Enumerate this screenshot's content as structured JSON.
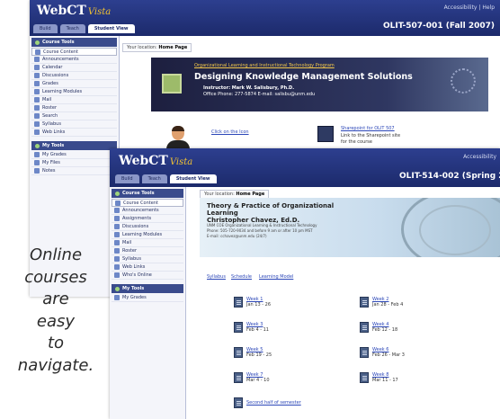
{
  "window_back": {
    "logo": "WebCT",
    "logo_sub": "Vista",
    "utility_links": "Accessibility | Help",
    "course_id": "OLIT-507-001 (Fall 2007)",
    "tabs": [
      "Build",
      "Teach",
      "Student View"
    ],
    "active_tab": "Student View",
    "breadcrumb_label": "Your location:",
    "breadcrumb_page": "Home Page",
    "sidebar": {
      "course_tools_heading": "Course Tools",
      "course_tools": [
        "Course Content",
        "Announcements",
        "Calendar",
        "Discussions",
        "Grades",
        "Learning Modules",
        "Mail",
        "Roster",
        "Search",
        "Syllabus",
        "Web Links"
      ],
      "my_tools_heading": "My Tools",
      "my_tools": [
        "My Grades",
        "My Files",
        "Notes"
      ]
    },
    "banner": {
      "program": "Organizational Learning and Instructional Technology Program",
      "title": "Designing Knowledge Management Solutions",
      "instructor": "Instructor: Mark W. Salisbury, Ph.D.",
      "office": "Office Phone: 277-5874  E-mail: salisbu@unm.edu"
    },
    "click_link": "Click on the Icon",
    "sharepoint_link": "Sharepoint for OLIT 507",
    "sharepoint_desc": "Link to the Sharepoint site for the course"
  },
  "window_front": {
    "logo": "WebCT",
    "logo_sub": "Vista",
    "utility_links": "Accessibility",
    "course_id": "OLIT-514-002 (Spring 2",
    "tabs": [
      "Build",
      "Teach",
      "Student View"
    ],
    "active_tab": "Student View",
    "breadcrumb_label": "Your location:",
    "breadcrumb_page": "Home Page",
    "sidebar": {
      "course_tools_heading": "Course Tools",
      "course_tools": [
        "Course Content",
        "Announcements",
        "Assignments",
        "Discussions",
        "Learning Modules",
        "Mail",
        "Roster",
        "Syllabus",
        "Web Links",
        "Who's Online"
      ],
      "my_tools_heading": "My Tools",
      "my_tools": [
        "My Grades"
      ]
    },
    "banner": {
      "title": "Theory & Practice of Organizational Learning",
      "instructor": "Christopher Chavez, Ed.D.",
      "line1": "UNM COE Organizational Learning & Instructional Technology",
      "line2": "Phone: 505-720-9034 and before 9 am or after 10 pm MST",
      "line3": "E-mail: cchavez@unm.edu (24/7)"
    },
    "nav_links": [
      "Syllabus",
      "Schedule",
      "Learning Model"
    ],
    "weeks": [
      {
        "label": "Week 1",
        "dates": "Jan 13 - 26"
      },
      {
        "label": "Week 2",
        "dates": "Jan 28 - Feb 4"
      },
      {
        "label": "Week 3",
        "dates": "Feb 4 - 11"
      },
      {
        "label": "Week 4",
        "dates": "Feb 12 - 18"
      },
      {
        "label": "Week 5",
        "dates": "Feb 19 - 25"
      },
      {
        "label": "Week 6",
        "dates": "Feb 26 - Mar 3"
      },
      {
        "label": "Week 7",
        "dates": "Mar 4 - 10"
      },
      {
        "label": "Week 8",
        "dates": "Mar 11 - 17"
      }
    ],
    "second_half": "Second half of semester"
  },
  "caption": [
    "Online",
    "courses",
    "are",
    "easy",
    "to",
    "navigate."
  ],
  "colors": {
    "header": "#1c2a6b",
    "link": "#2c47b8",
    "logo_accent": "#f1c232"
  }
}
